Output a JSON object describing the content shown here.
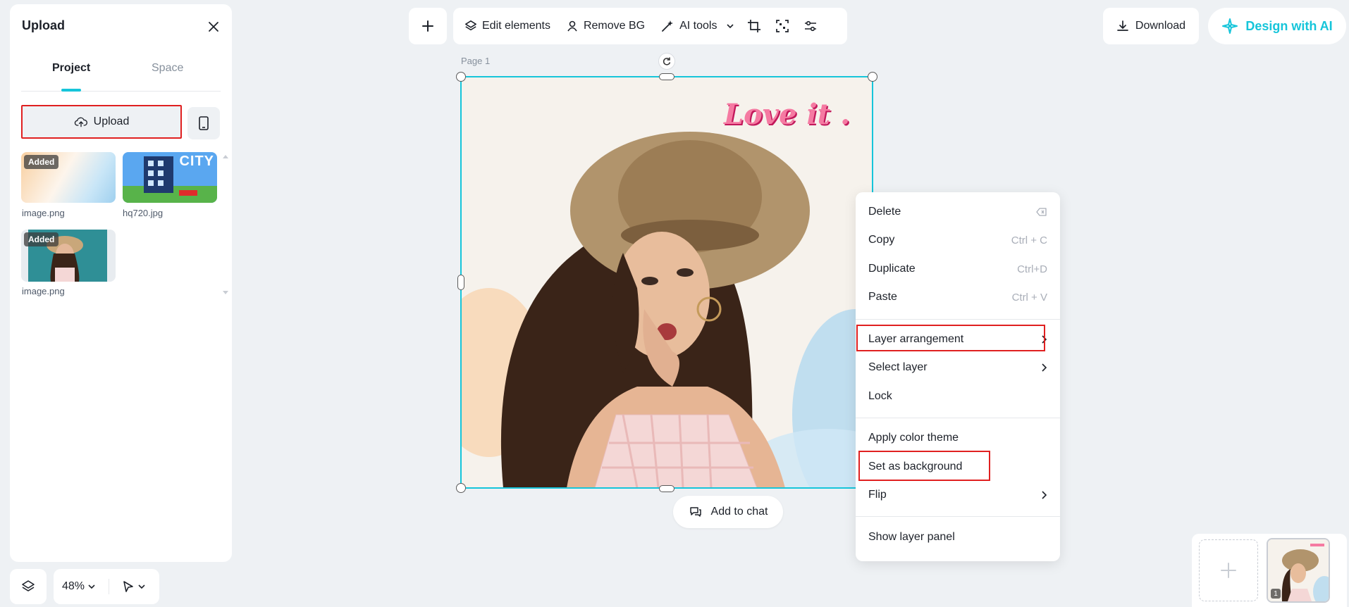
{
  "upload_panel": {
    "title": "Upload",
    "tabs": [
      {
        "label": "Project",
        "active": true
      },
      {
        "label": "Space",
        "active": false
      }
    ],
    "upload_button": "Upload",
    "assets": [
      {
        "name": "image.png",
        "badge": "Added"
      },
      {
        "name": "hq720.jpg",
        "overlay_text": "CITY"
      },
      {
        "name": "image.png",
        "badge": "Added"
      }
    ]
  },
  "toolbar": {
    "edit_elements": "Edit elements",
    "remove_bg": "Remove BG",
    "ai_tools": "AI tools",
    "download": "Download",
    "design_with_ai": "Design with AI"
  },
  "canvas": {
    "page_label": "Page 1",
    "overlay_text": "Love it .",
    "add_to_chat": "Add to chat"
  },
  "context_menu": {
    "items": [
      {
        "label": "Delete",
        "shortcut": ""
      },
      {
        "label": "Copy",
        "shortcut": "Ctrl + C"
      },
      {
        "label": "Duplicate",
        "shortcut": "Ctrl+D"
      },
      {
        "label": "Paste",
        "shortcut": "Ctrl + V"
      },
      {
        "label": "Layer arrangement",
        "submenu": true
      },
      {
        "label": "Select layer",
        "submenu": true
      },
      {
        "label": "Lock"
      },
      {
        "label": "Apply color theme"
      },
      {
        "label": "Set as background"
      },
      {
        "label": "Flip",
        "submenu": true
      },
      {
        "label": "Show layer panel"
      }
    ]
  },
  "footer": {
    "zoom": "48%",
    "page_number": "1"
  },
  "colors": {
    "accent": "#16c5da",
    "highlight": "#e02020",
    "background": "#eef1f4"
  }
}
